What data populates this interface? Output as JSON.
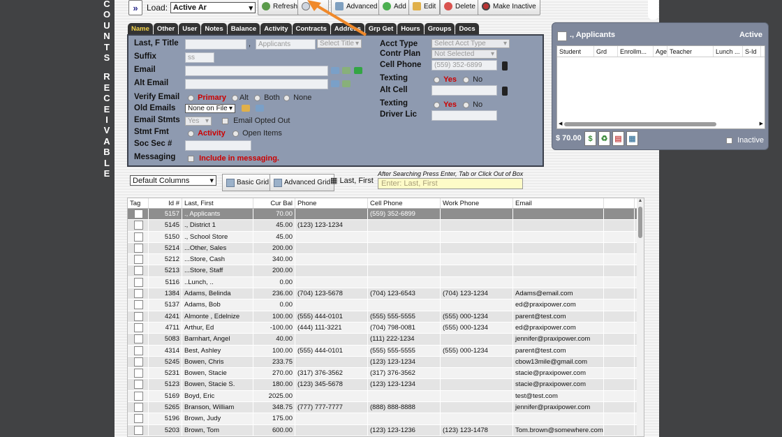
{
  "vertical_label": [
    "C",
    "O",
    "U",
    "N",
    "T",
    "S",
    "",
    "R",
    "E",
    "C",
    "E",
    "I",
    "V",
    "A",
    "B",
    "L",
    "E"
  ],
  "toolbar": {
    "load_label": "Load:",
    "load_value": "Active Ar",
    "buttons": [
      {
        "label": "Refresh",
        "icon": "refresh-icon"
      },
      {
        "label": "",
        "icon": "search-icon"
      },
      {
        "label": "Advanced",
        "icon": "advanced-icon"
      },
      {
        "label": "Add",
        "icon": "add-icon"
      },
      {
        "label": "Edit",
        "icon": "edit-icon"
      },
      {
        "label": "Delete",
        "icon": "delete-icon"
      },
      {
        "label": "Make Inactive",
        "icon": "inactive-icon"
      }
    ]
  },
  "tabs": [
    "Name",
    "Other",
    "User",
    "Notes",
    "Balance",
    "Activity",
    "Contracts",
    "Address",
    "Grp Get",
    "Hours",
    "Groups",
    "Docs"
  ],
  "form": {
    "last_first_title_label": "Last, F Title",
    "last_value": "",
    "first_value": "Applicants",
    "title_placeholder": "Select Title",
    "suffix_label": "Suffix",
    "suffix_value": "ss",
    "email_label": "Email",
    "email_value": "",
    "alt_email_label": "Alt Email",
    "alt_email_value": "",
    "verify_email_label": "Verify Email",
    "verify_options": [
      "Primary",
      "Alt",
      "Both",
      "None"
    ],
    "old_emails_label": "Old Emails",
    "old_emails_value": "None on File",
    "email_stmts_label": "Email Stmts",
    "email_stmts_value": "Yes",
    "email_opted_out_label": "Email Opted Out",
    "stmt_fmt_label": "Stmt Fmt",
    "stmt_fmt_options": [
      "Activity",
      "Open Items"
    ],
    "soc_sec_label": "Soc Sec #",
    "soc_sec_value": "",
    "messaging_label": "Messaging",
    "messaging_checkbox_label": "Include in messaging.",
    "acct_type_label": "Acct Type",
    "acct_type_value": "Select Acct Type",
    "contr_plan_label": "Contr Plan",
    "contr_plan_value": "Not Selected",
    "cell_phone_label": "Cell Phone",
    "cell_phone_value": "(559) 352-6899",
    "texting_label": "Texting",
    "yes_label": "Yes",
    "no_label": "No",
    "alt_cell_label": "Alt Cell",
    "alt_cell_value": "",
    "driver_lic_label": "Driver Lic",
    "driver_lic_value": ""
  },
  "grid_controls": {
    "columns_select": "Default Columns",
    "basic_grid": "Basic Grid",
    "advanced_grid": "Advanced Grid",
    "search_mode": "Last, First",
    "hint": "After Searching Press Enter, Tab or Click Out of Box",
    "search_placeholder": "Enter: Last, First"
  },
  "table": {
    "columns": [
      "Tag",
      "Id #",
      "Last, First",
      "Cur Bal",
      "Phone",
      "Cell Phone",
      "Work Phone",
      "Email",
      ""
    ],
    "rows": [
      [
        "",
        "5157",
        "., Applicants",
        "70.00",
        "",
        "(559) 352-6899",
        "",
        ""
      ],
      [
        "",
        "5145",
        "., District 1",
        "45.00",
        "(123) 123-1234",
        "",
        "",
        ""
      ],
      [
        "",
        "5150",
        "., School Store",
        "45.00",
        "",
        "",
        "",
        ""
      ],
      [
        "",
        "5214",
        "...Other, Sales",
        "200.00",
        "",
        "",
        "",
        ""
      ],
      [
        "",
        "5212",
        "...Store, Cash",
        "340.00",
        "",
        "",
        "",
        ""
      ],
      [
        "",
        "5213",
        "...Store, Staff",
        "200.00",
        "",
        "",
        "",
        ""
      ],
      [
        "",
        "5116",
        "..Lunch, ..",
        "0.00",
        "",
        "",
        "",
        ""
      ],
      [
        "",
        "1384",
        "Adams, Belinda",
        "236.00",
        "(704) 123-5678",
        "(704) 123-6543",
        "(704) 123-1234",
        "Adams@email.com"
      ],
      [
        "",
        "5137",
        "Adams, Bob",
        "0.00",
        "",
        "",
        "",
        "ed@praxipower.com"
      ],
      [
        "",
        "4241",
        "Almonte , Edelnize",
        "100.00",
        "(555) 444-0101",
        "(555) 555-5555",
        "(555) 000-1234",
        "parent@test.com"
      ],
      [
        "",
        "4711",
        "Arthur, Ed",
        "-100.00",
        "(444) 111-3221",
        "(704) 798-0081",
        "(555) 000-1234",
        "ed@praxipower.com"
      ],
      [
        "",
        "5083",
        "Barnhart, Angel",
        "40.00",
        "",
        "(111) 222-1234",
        "",
        "jennifer@praxipower.com"
      ],
      [
        "",
        "4314",
        "Best, Ashley",
        "100.00",
        "(555) 444-0101",
        "(555) 555-5555",
        "(555) 000-1234",
        "parent@test.com"
      ],
      [
        "",
        "5245",
        "Bowen, Chris",
        "233.75",
        "",
        "(123) 123-1234",
        "",
        "cbow13mile@gmail.com"
      ],
      [
        "",
        "5231",
        "Bowen, Stacie",
        "270.00",
        "(317) 376-3562",
        "(317) 376-3562",
        "",
        "stacie@praxipower.com"
      ],
      [
        "",
        "5123",
        "Bowen, Stacie S.",
        "180.00",
        "(123) 345-5678",
        "(123) 123-1234",
        "",
        "stacie@praxipower.com"
      ],
      [
        "",
        "5169",
        "Boyd, Eric",
        "2025.00",
        "",
        "",
        "",
        "test@test.com"
      ],
      [
        "",
        "5265",
        "Branson, William",
        "348.75",
        "(777) 777-7777",
        "(888) 888-8888",
        "",
        "jennifer@praxipower.com"
      ],
      [
        "",
        "5196",
        "Brown, Judy",
        "175.00",
        "",
        "",
        "",
        ""
      ],
      [
        "",
        "5203",
        "Brown, Tom",
        "600.00",
        "",
        "(123) 123-1236",
        "(123) 123-1478",
        "Tom.brown@somewhere.com"
      ]
    ]
  },
  "floating_panel": {
    "name": "., Applicants",
    "status": "Active",
    "columns": [
      "Student",
      "Grd",
      "Enrollm...",
      "Age",
      "Teacher",
      "Lunch ...",
      "S-Id"
    ],
    "balance": "$ 70.00",
    "inactive_label": "Inactive"
  },
  "colors": {
    "panel_bg": "#8e9ab0",
    "active_tab_text": "#f3d34a",
    "annotation_arrow": "#f0892a"
  }
}
